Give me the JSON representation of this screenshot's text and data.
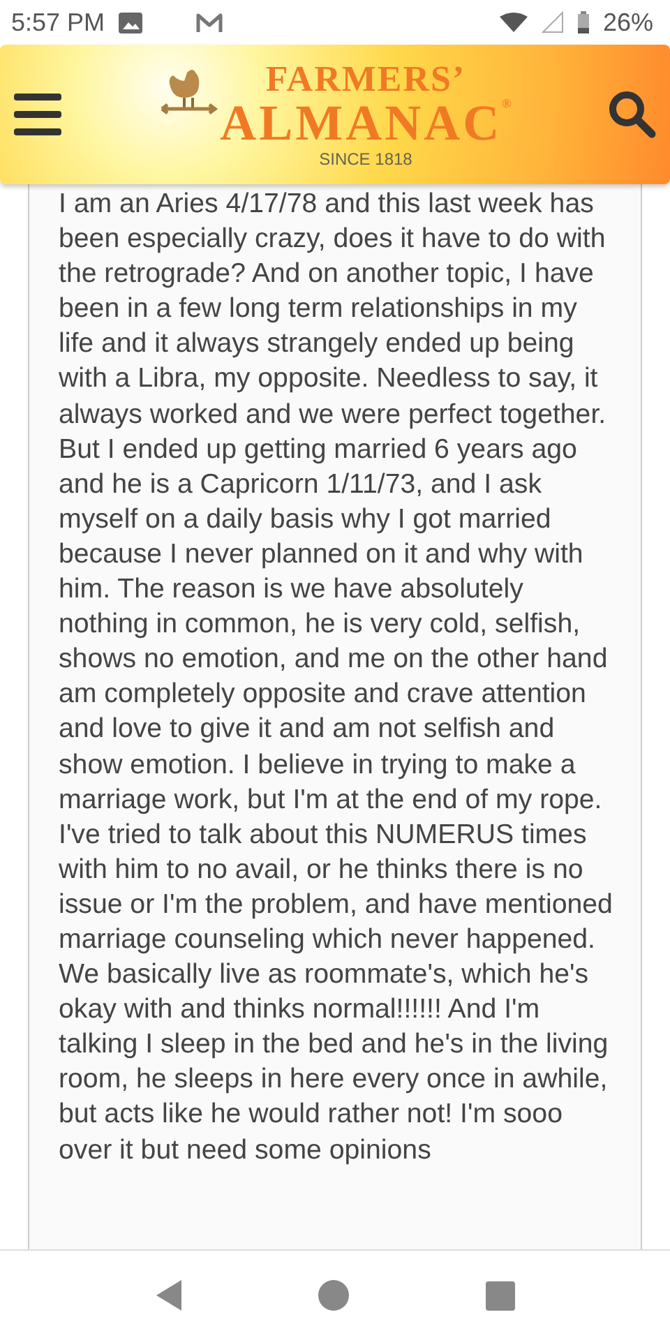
{
  "status_bar": {
    "time": "5:57 PM",
    "battery": "26%"
  },
  "header": {
    "logo": {
      "line_1": "FARMERS’",
      "line_2": "ALMANAC",
      "registered": "®",
      "tagline": "SINCE 1818"
    }
  },
  "comment": {
    "text": "I am an Aries 4/17/78 and this last week has been especially crazy, does it have to do with the retrograde? And on another topic, I have been in a few long term relationships in my life and it always strangely ended up being with a Libra, my opposite. Needless to say, it always worked and we were perfect together. But I ended up getting married 6 years ago and he is a Capricorn 1/11/73, and I ask myself on a daily basis why I got married because I never planned on it and why with him. The reason is we have absolutely nothing in common, he is very cold, selfish, shows no emotion, and me on the other hand am completely opposite and crave attention and love to give it and am not selfish and show emotion. I believe in trying to make a marriage work, but I'm at the end of my rope. I've tried to talk about this NUMERUS times with him to no avail, or he thinks there is no issue or I'm the problem, and have mentioned marriage counseling which never happened. We basically live as roommate's, which he's okay with and thinks normal!!!!!!  And I'm talking I sleep in the bed and he's in the living room, he sleeps in here every once in awhile, but acts like he would rather not! I'm sooo over it but need some opinions"
  }
}
